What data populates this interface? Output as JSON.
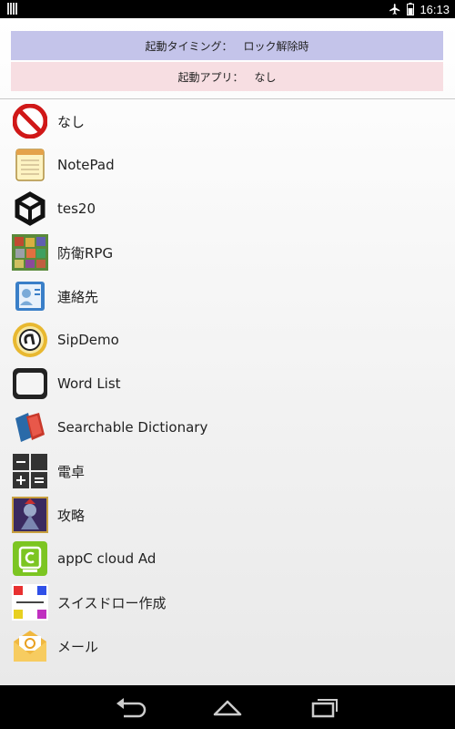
{
  "status": {
    "time": "16:13"
  },
  "settings": {
    "timing_label": "起動タイミング：",
    "timing_value": "ロック解除時",
    "app_label": "起動アプリ：",
    "app_value": "なし"
  },
  "apps": [
    {
      "label": "なし",
      "icon": "no-entry-icon"
    },
    {
      "label": "NotePad",
      "icon": "notepad-icon"
    },
    {
      "label": "tes20",
      "icon": "unity-icon"
    },
    {
      "label": "防衛RPG",
      "icon": "rpg-game-icon"
    },
    {
      "label": "連絡先",
      "icon": "contacts-icon"
    },
    {
      "label": "SipDemo",
      "icon": "sip-icon"
    },
    {
      "label": "Word List",
      "icon": "wordlist-icon"
    },
    {
      "label": "Searchable Dictionary",
      "icon": "books-icon"
    },
    {
      "label": "電卓",
      "icon": "calculator-icon"
    },
    {
      "label": "攻略",
      "icon": "game-character-icon"
    },
    {
      "label": "appC cloud Ad",
      "icon": "appc-icon"
    },
    {
      "label": "スイスドロー作成",
      "icon": "swiss-draw-icon"
    },
    {
      "label": "メール",
      "icon": "mail-icon"
    }
  ],
  "colors": {
    "header_timing_bg": "#c4c4ea",
    "header_app_bg": "#f7dee2",
    "no_entry_red": "#d01818",
    "appc_green": "#7cc522"
  }
}
